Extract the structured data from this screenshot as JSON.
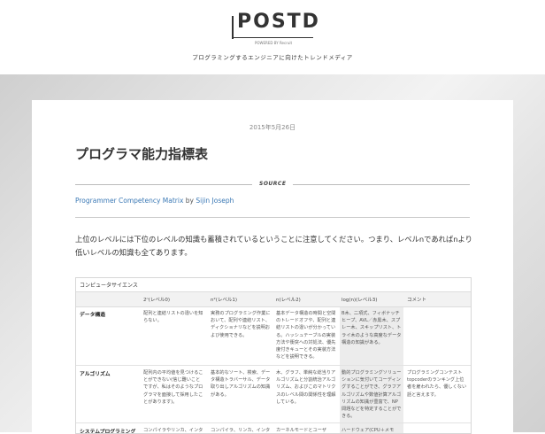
{
  "site": {
    "logo": "POSTD",
    "powered_by": "POWERED BY Recruit",
    "tagline": "プログラミングするエンジニアに向けたトレンドメディア"
  },
  "article": {
    "date": "2015年5月26日",
    "title": "プログラマ能力指標表",
    "source_label": "SOURCE",
    "source_link": "Programmer Competency Matrix",
    "source_by": " by ",
    "source_author": "Sijin Joseph",
    "intro": "上位のレベルには下位のレベルの知識も蓄積されているということに注意してください。つまり、レベル"
  },
  "matrix": {
    "section": "コンピュータサイエンス",
    "headers": [
      "2ⁿ(レベル0)",
      "n²(レベル1)",
      "n(レベル2)",
      "log(n)(レベル3)",
      "コメント"
    ],
    "rows": [
      {
        "label": "データ構造",
        "cells": [
          "配列と連結リストの違いを知らない。",
          "実務のプログラミング作業において、配列や連結リスト、ディクショナリなどを説明および使用できる。",
          "基本データ構造の時間と空間のトレードオフや、配列と連結リストの違いが分かっている。ハッシュテーブルの実装方法や衝突への対処法、優先度付きキューとその実装方法などを説明できる。",
          "B木、二項式、フィボナッチヒープ、AVL／赤黒木、スプレー木、スキップリスト、トライ木のような高度なデータ構造の知識がある。",
          ""
        ]
      },
      {
        "label": "アルゴリズム",
        "cells": [
          "配列内の平均値を見つけることができない(信じ難いことですが、私はそのようなプログラマを面接して採用したことがあります)。",
          "基本的なソート、検索、データ構造トラバーサル、データ取り出しアルゴリズムの知識がある。",
          "木、グラフ、単純な総当りアルゴリズムと分割統治アルゴリズム、およびこのマトリクスのレベル間の関係性を理解している。",
          "動的プログラミングソリューションに気付いてコーディングすることができ、グラフアルゴリズムや数値計算アルゴリズムの知識が豊富で、NP問題などを特定することができる。",
          "プログラミングコンテストtopcoderのランキング上位者を雇われたら、優しくない話と言えます。"
        ]
      },
      {
        "label": "システムプログラミング",
        "cells": [
          "コンパイラやリンカ、インタ",
          "コンパイラ、リンカ、インタ",
          "カーネルモードとユーザ",
          "ハードウェア(CPU＋メモ",
          ""
        ]
      }
    ]
  },
  "colors": {
    "link": "#3a78b5",
    "title": "#333333"
  }
}
